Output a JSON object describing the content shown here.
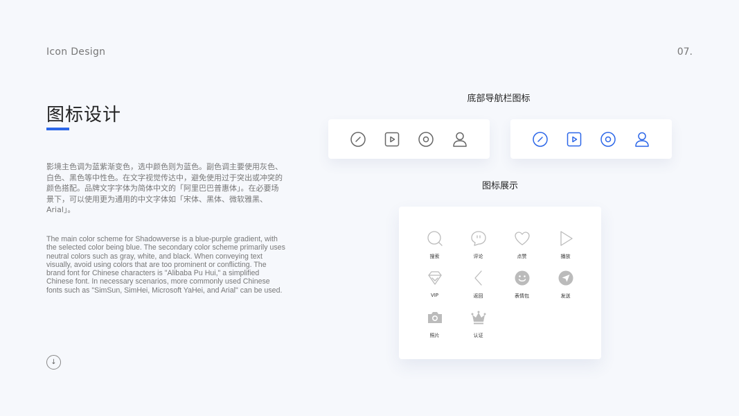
{
  "header": {
    "section": "Icon Design",
    "page_number": "07."
  },
  "main": {
    "title": "图标设计",
    "description_zh": "影境主色调为蓝紫渐变色，选中颜色则为蓝色。副色调主要使用灰色、白色、黑色等中性色。在文字视觉传达中，避免使用过于突出或冲突的颜色搭配。品牌文字字体为简体中文的「阿里巴巴普惠体」。在必要场景下，可以使用更为通用的中文字体如「宋体、黑体、微软雅黑、Arial」。",
    "description_en": "The main color scheme for Shadowverse is a blue-purple gradient, with the selected color being blue. The secondary color scheme primarily uses neutral colors such as gray, white, and black. When conveying text visually, avoid using colors that are too prominent or conflicting. The brand font for Chinese characters is \"Alibaba Pu Hui,\" a simplified Chinese font. In necessary scenarios, more commonly used Chinese fonts such as \"SimSun, SimHei, Microsoft YaHei, and Arial\" can be used."
  },
  "footer": {
    "down_button_glyph": "↓"
  },
  "nav_section": {
    "heading": "底部导航栏图标",
    "icons": [
      "compass-icon",
      "play-icon",
      "target-icon",
      "user-icon"
    ],
    "default_color": "#666666",
    "active_color": "#2b66e8"
  },
  "showcase": {
    "heading": "图标展示",
    "icon_color": "#bbbbbb",
    "items": [
      {
        "icon": "search-icon",
        "label": "搜索"
      },
      {
        "icon": "comment-icon",
        "label": "评论"
      },
      {
        "icon": "heart-icon",
        "label": "点赞"
      },
      {
        "icon": "play-icon",
        "label": "播放"
      },
      {
        "icon": "vip-diamond-icon",
        "label": "VIP"
      },
      {
        "icon": "back-icon",
        "label": "返回"
      },
      {
        "icon": "emoji-icon",
        "label": "表情包"
      },
      {
        "icon": "send-icon",
        "label": "发送"
      },
      {
        "icon": "camera-icon",
        "label": "照片"
      },
      {
        "icon": "crown-icon",
        "label": "认证"
      }
    ]
  }
}
